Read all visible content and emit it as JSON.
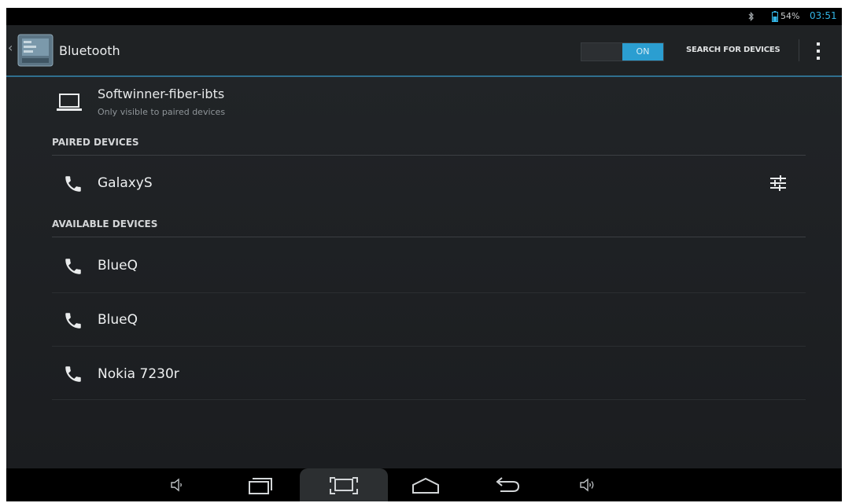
{
  "status_bar": {
    "battery_percent": "54%",
    "time": "03:51"
  },
  "header": {
    "title": "Bluetooth",
    "toggle": {
      "state_label": "ON",
      "on": true
    },
    "search_button": "SEARCH FOR DEVICES"
  },
  "this_device": {
    "name": "Softwinner-fiber-ibts",
    "visibility": "Only visible to paired devices"
  },
  "paired": {
    "header": "PAIRED DEVICES",
    "devices": [
      {
        "name": "GalaxyS",
        "icon": "phone-icon"
      }
    ]
  },
  "available": {
    "header": "AVAILABLE DEVICES",
    "devices": [
      {
        "name": "BlueQ",
        "icon": "phone-icon"
      },
      {
        "name": "BlueQ",
        "icon": "phone-icon"
      },
      {
        "name": "Nokia 7230r",
        "icon": "phone-icon"
      }
    ]
  },
  "nav": [
    "volume-down-icon",
    "recent-apps-icon",
    "screenshot-icon",
    "home-icon",
    "back-icon",
    "volume-up-icon"
  ],
  "colors": {
    "accent": "#2b9ed1",
    "background": "#1b1d20"
  }
}
